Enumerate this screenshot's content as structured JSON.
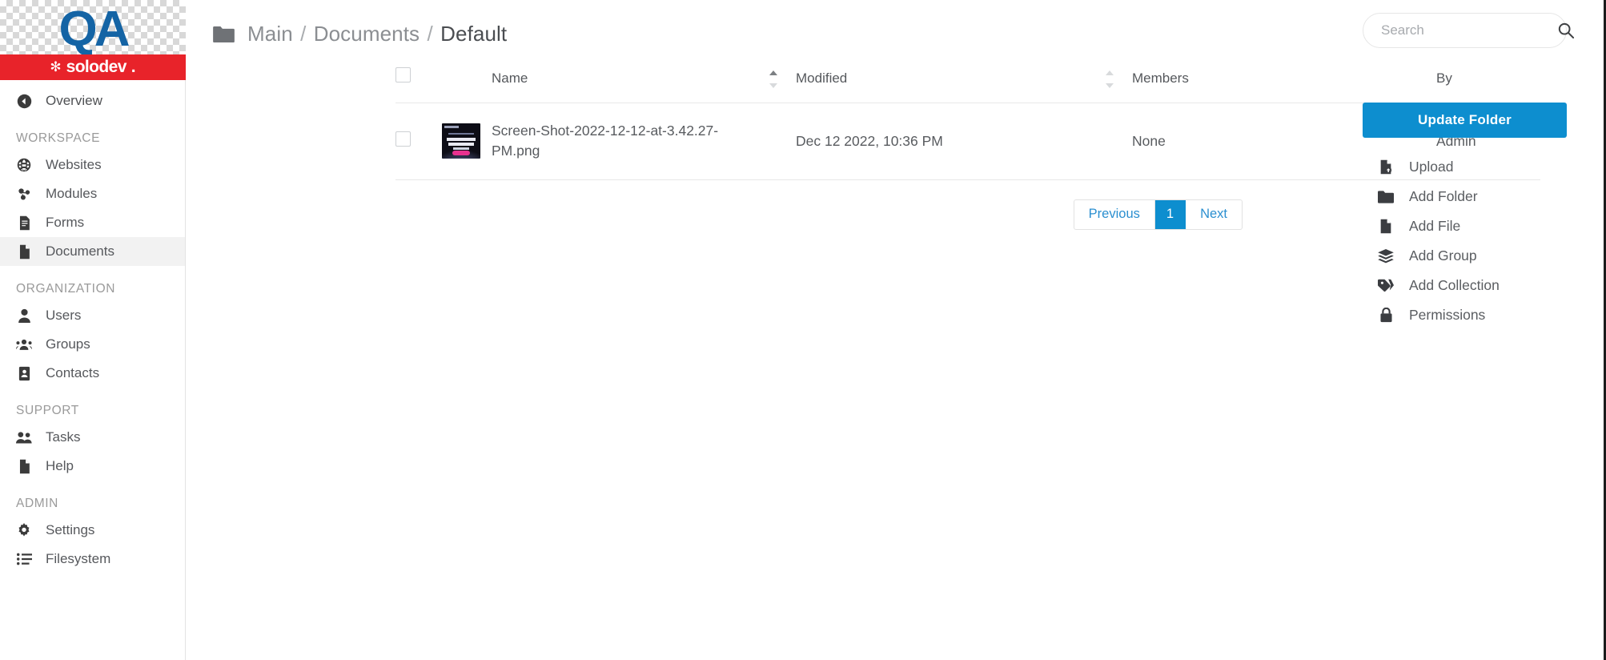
{
  "brand": {
    "logo_text": "QA",
    "banner_word": "solodev",
    "banner_dot": ".",
    "banner_star": "✻",
    "red": "#e8232a",
    "blue": "#1464a5"
  },
  "accent": {
    "primary_blue": "#0d8ecf",
    "link_blue": "#2b8fd0"
  },
  "sidebar": {
    "overview": {
      "label": "Overview",
      "icon": "back-circle-icon"
    },
    "groups": [
      {
        "label": "WORKSPACE",
        "items": [
          {
            "label": "Websites",
            "icon": "globe-icon",
            "active": false
          },
          {
            "label": "Modules",
            "icon": "modules-icon",
            "active": false
          },
          {
            "label": "Forms",
            "icon": "form-icon",
            "active": false
          },
          {
            "label": "Documents",
            "icon": "document-icon",
            "active": true
          }
        ]
      },
      {
        "label": "ORGANIZATION",
        "items": [
          {
            "label": "Users",
            "icon": "user-icon",
            "active": false
          },
          {
            "label": "Groups",
            "icon": "groups-icon",
            "active": false
          },
          {
            "label": "Contacts",
            "icon": "contact-card-icon",
            "active": false
          }
        ]
      },
      {
        "label": "SUPPORT",
        "items": [
          {
            "label": "Tasks",
            "icon": "tasks-people-icon",
            "active": false
          },
          {
            "label": "Help",
            "icon": "document-icon",
            "active": false
          }
        ]
      },
      {
        "label": "ADMIN",
        "items": [
          {
            "label": "Settings",
            "icon": "gear-icon",
            "active": false
          },
          {
            "label": "Filesystem",
            "icon": "list-icon",
            "active": false
          }
        ]
      }
    ]
  },
  "header": {
    "folder_icon": "folder-icon",
    "breadcrumb": [
      "Main",
      "Documents",
      "Default"
    ],
    "separator": "/"
  },
  "search": {
    "placeholder": "Search",
    "value": "",
    "icon": "search-icon"
  },
  "table": {
    "columns": [
      {
        "key": "check",
        "label": "",
        "sortable": false
      },
      {
        "key": "thumb",
        "label": "",
        "sortable": false
      },
      {
        "key": "name",
        "label": "Name",
        "sortable": true,
        "sort": "asc"
      },
      {
        "key": "modified",
        "label": "Modified",
        "sortable": true,
        "sort": "none"
      },
      {
        "key": "members",
        "label": "Members",
        "sortable": false
      },
      {
        "key": "by",
        "label": "By",
        "sortable": false
      }
    ],
    "rows": [
      {
        "name": "Screen-Shot-2022-12-12-at-3.42.27-PM.png",
        "modified": "Dec 12 2022, 10:36 PM",
        "members": "None",
        "by": "Admin"
      }
    ]
  },
  "pagination": {
    "previous": "Previous",
    "pages": [
      "1"
    ],
    "current": "1",
    "next": "Next"
  },
  "actions": {
    "primary": {
      "label": "Update Folder"
    },
    "items": [
      {
        "label": "Upload",
        "icon": "file-upload-icon"
      },
      {
        "label": "Add Folder",
        "icon": "folder-icon"
      },
      {
        "label": "Add File",
        "icon": "file-icon"
      },
      {
        "label": "Add Group",
        "icon": "layers-icon"
      },
      {
        "label": "Add Collection",
        "icon": "tags-icon"
      },
      {
        "label": "Permissions",
        "icon": "lock-icon"
      }
    ]
  }
}
